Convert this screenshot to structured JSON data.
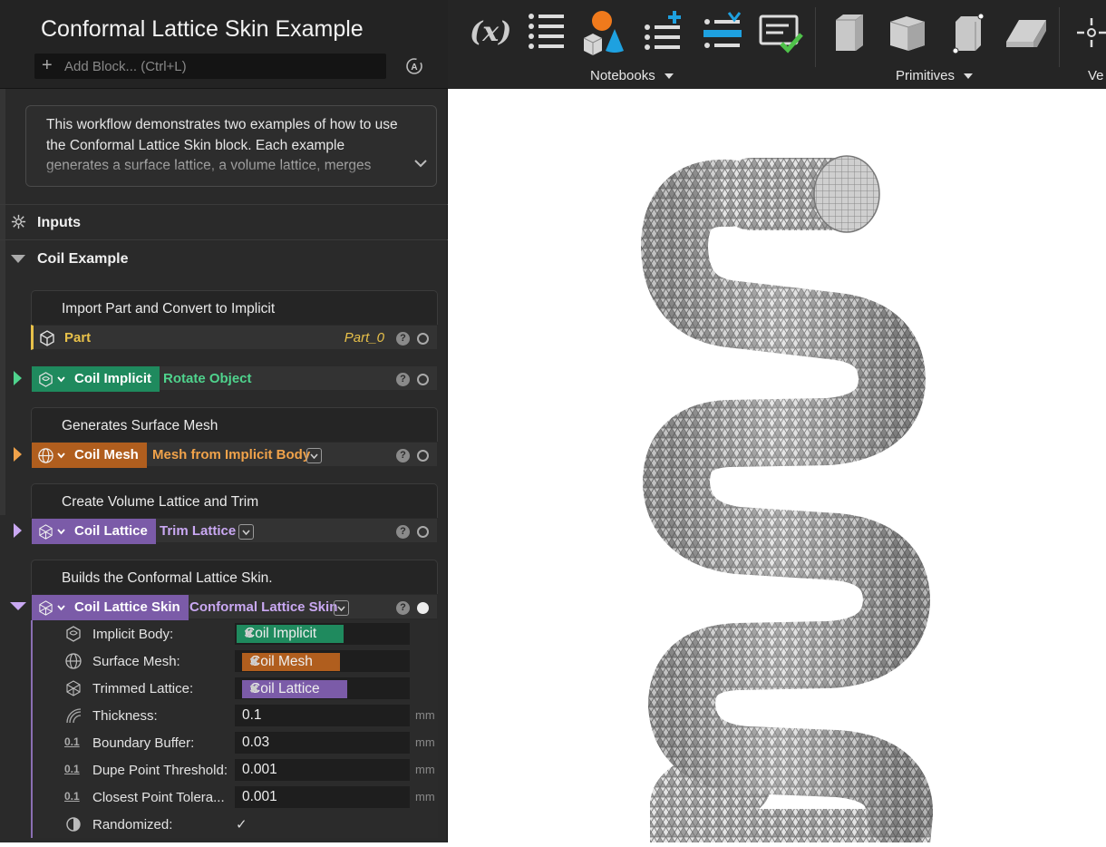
{
  "header": {
    "title": "Conformal Lattice Skin Example",
    "add_block_placeholder": "Add Block... (Ctrl+L)"
  },
  "description": {
    "text": "This workflow demonstrates two examples of how to use the Conformal Lattice Skin block. Each example generates a surface lattice, a volume lattice, merges"
  },
  "tree": {
    "inputs_label": "Inputs",
    "group_label": "Coil Example"
  },
  "groups": [
    {
      "title": "Import Part and Convert to Implicit"
    },
    {
      "title": "Generates Surface Mesh"
    },
    {
      "title": "Create Volume Lattice and Trim"
    },
    {
      "title": "Builds the Conformal Lattice Skin."
    }
  ],
  "blocks": {
    "part": {
      "name": "Part",
      "value": "Part_0",
      "color": "#e8c14a"
    },
    "coil_implicit": {
      "name": "Coil Implicit",
      "op": "Rotate Object",
      "color": "#1f8a5e",
      "op_color": "#4fd38d"
    },
    "coil_mesh": {
      "name": "Coil Mesh",
      "op": "Mesh from Implicit Body",
      "color": "#b05e1e",
      "op_color": "#f0a24a"
    },
    "coil_lattice": {
      "name": "Coil Lattice",
      "op": "Trim Lattice",
      "color": "#7b5ba8",
      "op_color": "#c9a8f2"
    },
    "coil_skin": {
      "name": "Coil Lattice Skin",
      "op": "Conformal Lattice Skin",
      "color": "#7b5ba8",
      "op_color": "#c9a8f2"
    }
  },
  "params": {
    "implicit_body": {
      "label": "Implicit Body:",
      "value": "Coil Implicit"
    },
    "surface_mesh": {
      "label": "Surface Mesh:",
      "value": "Coil Mesh"
    },
    "trimmed_lattice": {
      "label": "Trimmed Lattice:",
      "value": "Coil Lattice"
    },
    "thickness": {
      "label": "Thickness:",
      "value": "0.1",
      "unit": "mm"
    },
    "boundary_buffer": {
      "label": "Boundary Buffer:",
      "value": "0.03",
      "unit": "mm"
    },
    "dupe_point": {
      "label": "Dupe Point Threshold:",
      "value": "0.001",
      "unit": "mm"
    },
    "closest_point": {
      "label": "Closest Point Tolera...",
      "value": "0.001",
      "unit": "mm"
    },
    "randomized": {
      "label": "Randomized:",
      "checked": true,
      "check_glyph": "✓"
    }
  },
  "toolbar": {
    "var_label": "(x)",
    "notebooks_label": "Notebooks",
    "primitives_label": "Primitives",
    "vectors_label": "Ve"
  }
}
